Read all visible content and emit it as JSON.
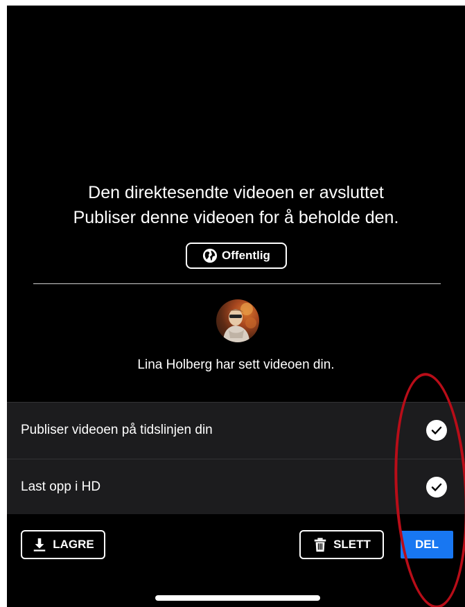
{
  "header": {
    "title": "Den direktesendte videoen er avsluttet",
    "subtitle": "Publiser denne videoen for å beholde den."
  },
  "privacy": {
    "label": "Offentlig",
    "icon": "globe-icon"
  },
  "viewer": {
    "avatar": "profile-photo",
    "text": "Lina Holberg har sett videoen din."
  },
  "options": [
    {
      "label": "Publiser videoen på tidslinjen din",
      "checked": true
    },
    {
      "label": "Last opp i HD",
      "checked": true
    }
  ],
  "actions": {
    "save_label": "LAGRE",
    "delete_label": "SLETT",
    "share_label": "DEL"
  },
  "colors": {
    "background": "#000000",
    "options_background": "#1c1c1e",
    "accent": "#1877f2",
    "annotation": "#b80d18"
  }
}
